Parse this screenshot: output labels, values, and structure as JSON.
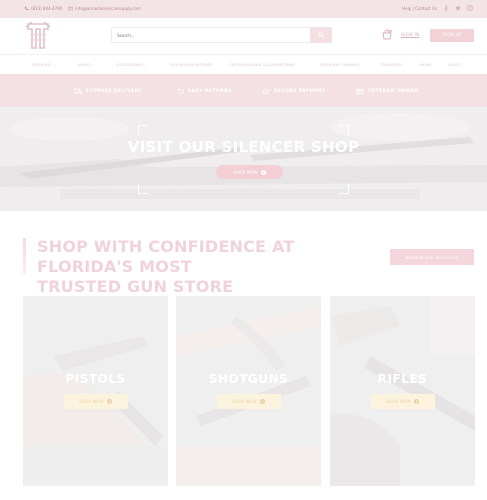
{
  "topbar": {
    "phone": "(813) 844-4780",
    "email": "info@armedamericansupply.com",
    "contact_link": "Help | Contact Us",
    "social": [
      "facebook-icon",
      "twitter-icon",
      "instagram-icon"
    ]
  },
  "header": {
    "search_placeholder": "Search...",
    "signin_label": "SIGN IN",
    "signup_label": "SIGN UP"
  },
  "nav": {
    "items": [
      {
        "label": "FIREARMS",
        "has_dropdown": true
      },
      {
        "label": "AMMO",
        "has_dropdown": true
      },
      {
        "label": "ACCESSORIES",
        "has_dropdown": true
      },
      {
        "label": "GUN BUYBACK/TRADE",
        "has_dropdown": false
      },
      {
        "label": "CUSTOM BUILDS & GUNSMITHING",
        "has_dropdown": false
      },
      {
        "label": "FIREARMS TRAINING",
        "has_dropdown": false
      },
      {
        "label": "TRANSFERS",
        "has_dropdown": false
      },
      {
        "label": "NEWS",
        "has_dropdown": false
      },
      {
        "label": "SALES",
        "has_dropdown": false
      }
    ]
  },
  "features": [
    {
      "label": "EXPRESS DELIVERY",
      "icon": "truck-icon"
    },
    {
      "label": "EASY RETURNS",
      "icon": "return-icon"
    },
    {
      "label": "SECURE PAYMENT",
      "icon": "shield-check-icon"
    },
    {
      "label": "VETERAN OWNED",
      "icon": "flag-icon"
    }
  ],
  "banner": {
    "title": "VISIT OUR SILENCER SHOP",
    "button_label": "SHOP NOW"
  },
  "confidence": {
    "headline_line1": "SHOP WITH CONFIDENCE AT FLORIDA'S MOST",
    "headline_line2": "TRUSTED GUN STORE",
    "browse_label": "BROWSE OUR SELECTION"
  },
  "categories": [
    {
      "title": "PISTOLS",
      "button_label": "SHOP NOW"
    },
    {
      "title": "SHOTGUNS",
      "button_label": "SHOP NOW"
    },
    {
      "title": "RIFLES",
      "button_label": "SHOP NOW"
    }
  ],
  "colors": {
    "accent": "#f3cfd5",
    "accent_light": "#f3e4e6",
    "gold_button": "#fbf3dd"
  }
}
